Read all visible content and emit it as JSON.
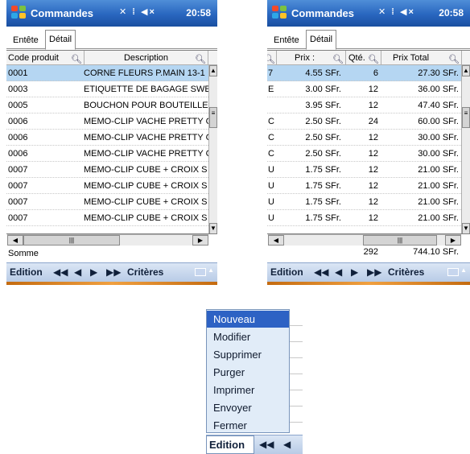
{
  "colors": {
    "titlebar": "#2966bf",
    "selected_row": "#b5d6f2",
    "menu_highlight": "#2d62c4",
    "menu_bg": "#e1ecf8"
  },
  "status": {
    "icons": "✕ ⁞ ◀×",
    "time": "20:58"
  },
  "screenA": {
    "app_title": "Commandes",
    "tabs": [
      {
        "label": "Entête"
      },
      {
        "label": "Détail"
      }
    ],
    "columns": [
      {
        "label": "Code produit"
      },
      {
        "label": "Description"
      }
    ],
    "rows": [
      {
        "code": "0001",
        "description": "CORNE FLEURS P.MAIN 13-1"
      },
      {
        "code": "0003",
        "description": "ETIQUETTE DE BAGAGE SWE"
      },
      {
        "code": "0005",
        "description": "BOUCHON POUR BOUTEILLE"
      },
      {
        "code": "0006",
        "description": "MEMO-CLIP VACHE PRETTY C"
      },
      {
        "code": "0006",
        "description": "MEMO-CLIP VACHE PRETTY C"
      },
      {
        "code": "0006",
        "description": "MEMO-CLIP VACHE PRETTY C"
      },
      {
        "code": "0007",
        "description": "MEMO-CLIP CUBE + CROIX S"
      },
      {
        "code": "0007",
        "description": "MEMO-CLIP CUBE + CROIX S"
      },
      {
        "code": "0007",
        "description": "MEMO-CLIP CUBE + CROIX S"
      },
      {
        "code": "0007",
        "description": "MEMO-CLIP CUBE + CROIX S"
      }
    ],
    "summary_label": "Somme",
    "cmd_label": "Edition",
    "nav": {
      "first": "◀◀",
      "prev": "◀",
      "next": "▶",
      "last": "▶▶"
    },
    "criteria_label": "Critères"
  },
  "screenB": {
    "app_title": "Commandes",
    "tabs": [
      {
        "label": "Entête"
      },
      {
        "label": "Détail"
      }
    ],
    "columns": [
      {
        "label": "Prix :"
      },
      {
        "label": "Qté."
      },
      {
        "label": "Prix Total"
      }
    ],
    "rows": [
      {
        "cut": "7",
        "price": "4.55 SFr.",
        "qty": "6",
        "total": "27.30 SFr."
      },
      {
        "cut": "E",
        "price": "3.00 SFr.",
        "qty": "12",
        "total": "36.00 SFr."
      },
      {
        "cut": "",
        "price": "3.95 SFr.",
        "qty": "12",
        "total": "47.40 SFr."
      },
      {
        "cut": "C",
        "price": "2.50 SFr.",
        "qty": "24",
        "total": "60.00 SFr."
      },
      {
        "cut": "C",
        "price": "2.50 SFr.",
        "qty": "12",
        "total": "30.00 SFr."
      },
      {
        "cut": "C",
        "price": "2.50 SFr.",
        "qty": "12",
        "total": "30.00 SFr."
      },
      {
        "cut": "U",
        "price": "1.75 SFr.",
        "qty": "12",
        "total": "21.00 SFr."
      },
      {
        "cut": "U",
        "price": "1.75 SFr.",
        "qty": "12",
        "total": "21.00 SFr."
      },
      {
        "cut": "U",
        "price": "1.75 SFr.",
        "qty": "12",
        "total": "21.00 SFr."
      },
      {
        "cut": "U",
        "price": "1.75 SFr.",
        "qty": "12",
        "total": "21.00 SFr."
      }
    ],
    "summary": {
      "qty": "292",
      "total": "744.10 SFr."
    },
    "cmd_label": "Edition",
    "nav": {
      "first": "◀◀",
      "prev": "◀",
      "next": "▶",
      "last": "▶▶"
    },
    "criteria_label": "Critères"
  },
  "menu": {
    "items": [
      {
        "label": "Nouveau"
      },
      {
        "label": "Modifier"
      },
      {
        "label": "Supprimer"
      },
      {
        "label": "Purger"
      },
      {
        "label": "Imprimer"
      },
      {
        "label": "Envoyer"
      },
      {
        "label": "Fermer"
      }
    ],
    "selected": "Nouveau",
    "cmd_label": "Edition",
    "nav": {
      "first": "◀◀",
      "prev": "◀"
    }
  }
}
